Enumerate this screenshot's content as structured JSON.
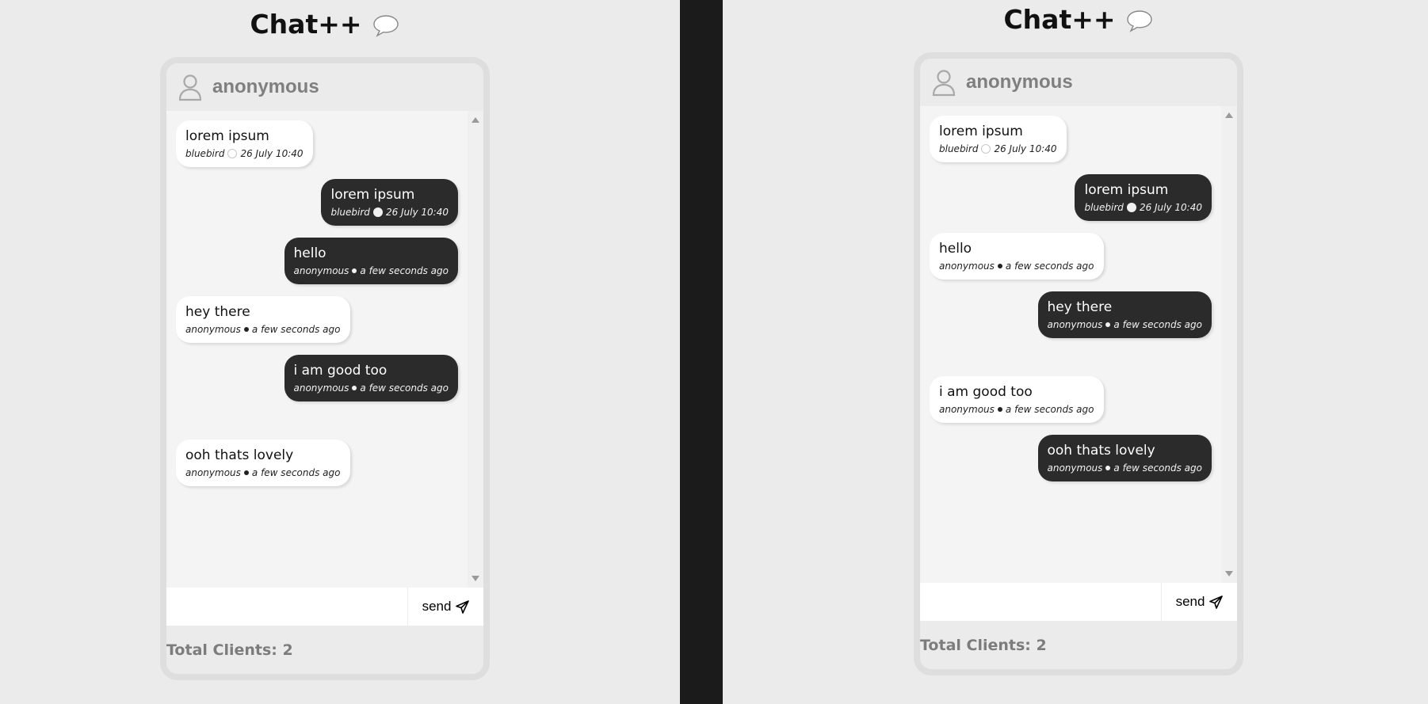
{
  "left": {
    "title": "Chat++",
    "header_user": "anonymous",
    "messages": [
      {
        "text": "lorem ipsum",
        "author": "bluebird",
        "time": "26 July 10:40",
        "side": "in",
        "status": "hollow"
      },
      {
        "text": "lorem ipsum",
        "author": "bluebird",
        "time": "26 July 10:40",
        "side": "out",
        "status": "solid"
      },
      {
        "text": "hello",
        "author": "anonymous",
        "time": "a few seconds ago",
        "side": "out",
        "status": "tiny"
      },
      {
        "text": "hey there",
        "author": "anonymous",
        "time": "a few seconds ago",
        "side": "in",
        "status": "tiny"
      },
      {
        "text": "i am good too",
        "author": "anonymous",
        "time": "a few seconds ago",
        "side": "out",
        "status": "tiny"
      },
      {
        "text": "ooh thats lovely",
        "author": "anonymous",
        "time": "a few seconds ago",
        "side": "in",
        "status": "tiny"
      }
    ],
    "input_value": "",
    "send_label": "send",
    "clients_label": "Total Clients: 2"
  },
  "right": {
    "title": "Chat++",
    "header_user": "anonymous",
    "messages": [
      {
        "text": "lorem ipsum",
        "author": "bluebird",
        "time": "26 July 10:40",
        "side": "in",
        "status": "hollow"
      },
      {
        "text": "lorem ipsum",
        "author": "bluebird",
        "time": "26 July 10:40",
        "side": "out",
        "status": "solid"
      },
      {
        "text": "hello",
        "author": "anonymous",
        "time": "a few seconds ago",
        "side": "in",
        "status": "tiny"
      },
      {
        "text": "hey there",
        "author": "anonymous",
        "time": "a few seconds ago",
        "side": "out",
        "status": "tiny"
      },
      {
        "text": "i am good too",
        "author": "anonymous",
        "time": "a few seconds ago",
        "side": "in",
        "status": "tiny"
      },
      {
        "text": "ooh thats lovely",
        "author": "anonymous",
        "time": "a few seconds ago",
        "side": "out",
        "status": "tiny"
      }
    ],
    "input_value": "",
    "send_label": "send",
    "clients_label": "Total Clients: 2"
  },
  "colors": {
    "page_bg": "#ebebeb",
    "divider": "#1b1b1b",
    "bubble_in": "#ffffff",
    "bubble_out": "#2b2b2b",
    "muted_text": "#7f7f7f"
  },
  "icons": {
    "title_icon": "speech-bubble-icon",
    "header_icon": "user-icon",
    "send_icon": "paper-plane-icon"
  }
}
